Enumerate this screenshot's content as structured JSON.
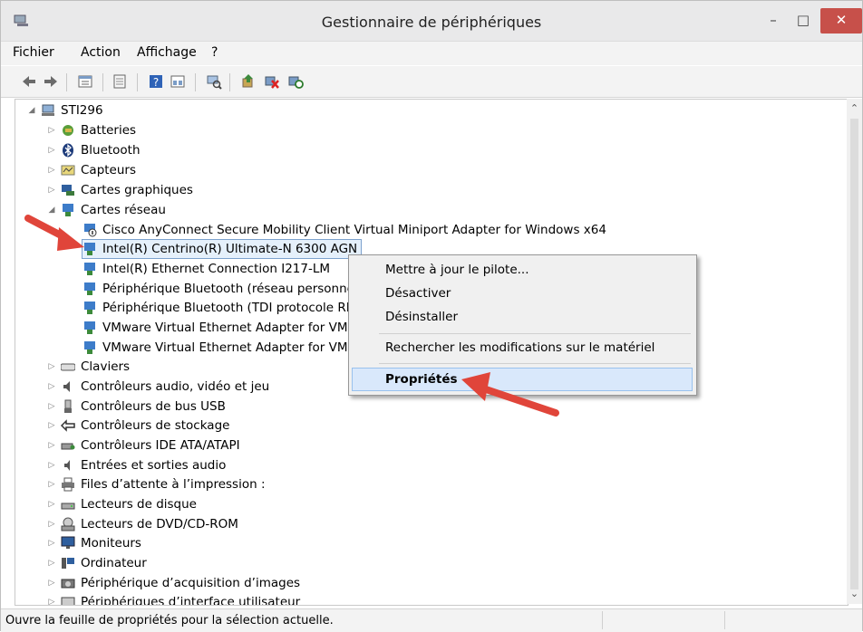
{
  "window": {
    "title": "Gestionnaire de périphériques",
    "minimize": "–",
    "maximize": "□",
    "close": "✕"
  },
  "menu": [
    "Fichier",
    "Action",
    "Affichage",
    "?"
  ],
  "tree": {
    "root": "STI296",
    "categories": {
      "batteries": "Batteries",
      "bluetooth": "Bluetooth",
      "capteurs": "Capteurs",
      "cartes_graphiques": "Cartes graphiques",
      "cartes_reseau": "Cartes réseau",
      "claviers": "Claviers",
      "audio_video_jeu": "Contrôleurs audio, vidéo et jeu",
      "bus_usb": "Contrôleurs de bus USB",
      "stockage": "Contrôleurs de stockage",
      "ide_ata": "Contrôleurs IDE ATA/ATAPI",
      "entrees_sorties_audio": "Entrées et sorties audio",
      "files_impression": "Files d’attente à l’impression :",
      "lecteurs_disque": "Lecteurs de disque",
      "lecteurs_dvd": "Lecteurs de DVD/CD-ROM",
      "moniteurs": "Moniteurs",
      "ordinateur": "Ordinateur",
      "acquisition_images": "Périphérique d’acquisition d’images",
      "interface_utilisateur": "Périphériques d’interface utilisateur"
    },
    "network_adapters": [
      "Cisco AnyConnect Secure Mobility Client Virtual Miniport Adapter for Windows x64",
      "Intel(R) Centrino(R) Ultimate-N 6300 AGN",
      "Intel(R) Ethernet Connection I217-LM",
      "Périphérique Bluetooth (réseau personnel)",
      "Périphérique Bluetooth (TDI protocole RFC",
      "VMware Virtual Ethernet Adapter for VMne",
      "VMware Virtual Ethernet Adapter for VMne"
    ]
  },
  "context_menu": {
    "update": "Mettre à jour le pilote...",
    "disable": "Désactiver",
    "uninstall": "Désinstaller",
    "scan": "Rechercher les modifications sur le matériel",
    "properties": "Propriétés"
  },
  "status": {
    "text": "Ouvre la feuille de propriétés pour la sélection actuelle."
  },
  "icons": [
    "app-icon",
    "back-icon",
    "forward-icon",
    "properties-icon",
    "update-icon",
    "help-icon",
    "view-icon",
    "scan-icon",
    "install-icon",
    "disable-icon",
    "refresh-icon",
    "computer-icon",
    "network-adapter-icon"
  ],
  "colors": {
    "close": "#c7504a",
    "highlight": "#d9e8fb",
    "selection": "#e5f0fb",
    "annotation_arrow": "#e0453a"
  }
}
